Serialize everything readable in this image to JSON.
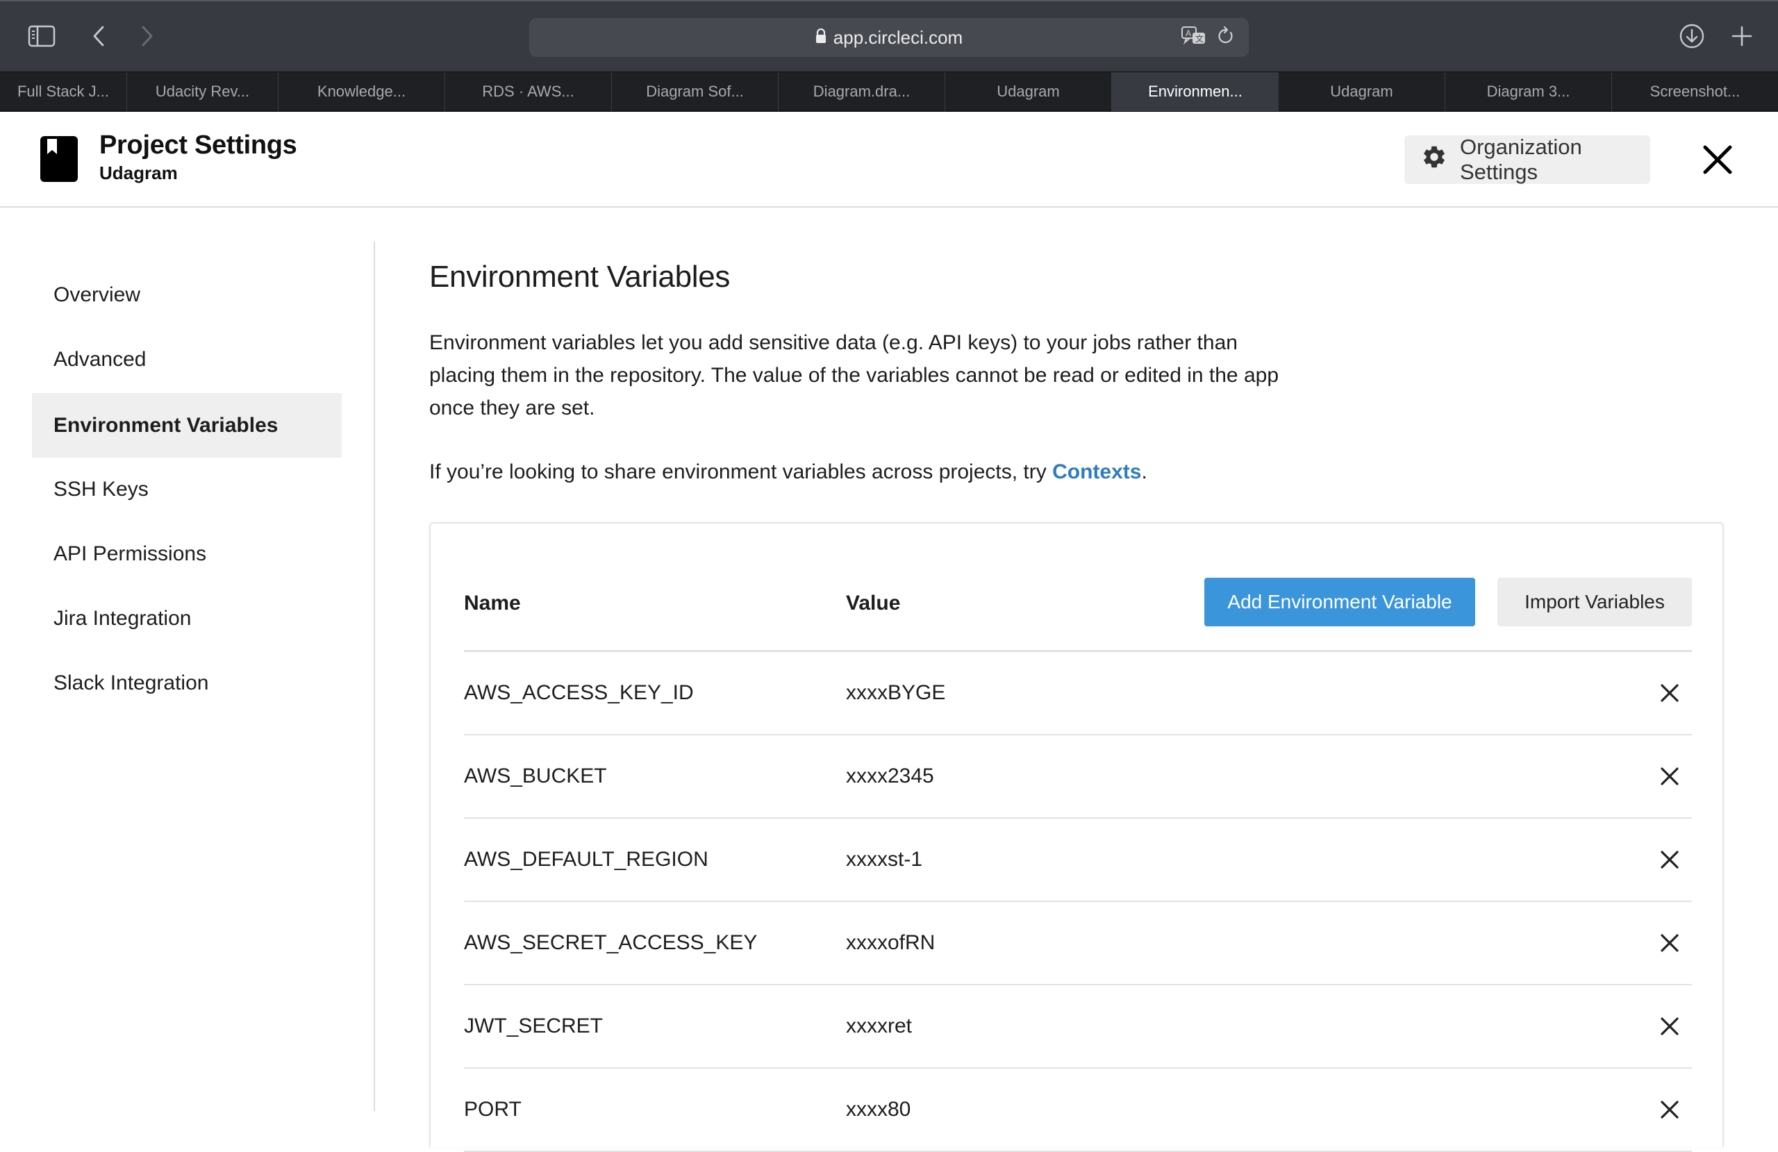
{
  "browser": {
    "url": "app.circleci.com",
    "icons": {
      "sidebar": "sidebar-toggle-icon",
      "back": "chevron-left-icon",
      "forward": "chevron-right-icon",
      "lock": "lock-icon",
      "translate": "translate-icon",
      "reload": "reload-icon",
      "download": "download-icon",
      "new_tab": "plus-icon"
    },
    "tabs": [
      {
        "label": "Full Stack J...",
        "active": false
      },
      {
        "label": "Udacity Rev...",
        "active": false
      },
      {
        "label": "Knowledge...",
        "active": false
      },
      {
        "label": "RDS · AWS...",
        "active": false
      },
      {
        "label": "Diagram Sof...",
        "active": false
      },
      {
        "label": "Diagram.dra...",
        "active": false
      },
      {
        "label": "Udagram",
        "active": false
      },
      {
        "label": "Environmen...",
        "active": true
      },
      {
        "label": "Udagram",
        "active": false
      },
      {
        "label": "Diagram 3...",
        "active": false
      },
      {
        "label": "Screenshot...",
        "active": false
      }
    ]
  },
  "header": {
    "title": "Project Settings",
    "project": "Udagram",
    "org_settings_label": "Organization Settings"
  },
  "sidebar": {
    "items": [
      {
        "label": "Overview",
        "active": false
      },
      {
        "label": "Advanced",
        "active": false
      },
      {
        "label": "Environment Variables",
        "active": true
      },
      {
        "label": "SSH Keys",
        "active": false
      },
      {
        "label": "API Permissions",
        "active": false
      },
      {
        "label": "Jira Integration",
        "active": false
      },
      {
        "label": "Slack Integration",
        "active": false
      }
    ]
  },
  "main": {
    "title": "Environment Variables",
    "description": "Environment variables let you add sensitive data (e.g. API keys) to your jobs rather than placing them in the repository. The value of the variables cannot be read or edited in the app once they are set.",
    "share_prefix": "If you’re looking to share environment variables across projects, try ",
    "share_link": "Contexts",
    "share_suffix": ".",
    "table": {
      "col_name": "Name",
      "col_value": "Value",
      "add_button": "Add Environment Variable",
      "import_button": "Import Variables",
      "rows": [
        {
          "name": "AWS_ACCESS_KEY_ID",
          "value": "xxxxBYGE"
        },
        {
          "name": "AWS_BUCKET",
          "value": "xxxx2345"
        },
        {
          "name": "AWS_DEFAULT_REGION",
          "value": "xxxxst-1"
        },
        {
          "name": "AWS_SECRET_ACCESS_KEY",
          "value": "xxxxofRN"
        },
        {
          "name": "JWT_SECRET",
          "value": "xxxxret"
        },
        {
          "name": "PORT",
          "value": "xxxx80"
        }
      ]
    }
  },
  "colors": {
    "accent": "#3b95db",
    "link": "#2f7cbc",
    "chrome": "#373a41",
    "tabbar": "#1f2023"
  }
}
